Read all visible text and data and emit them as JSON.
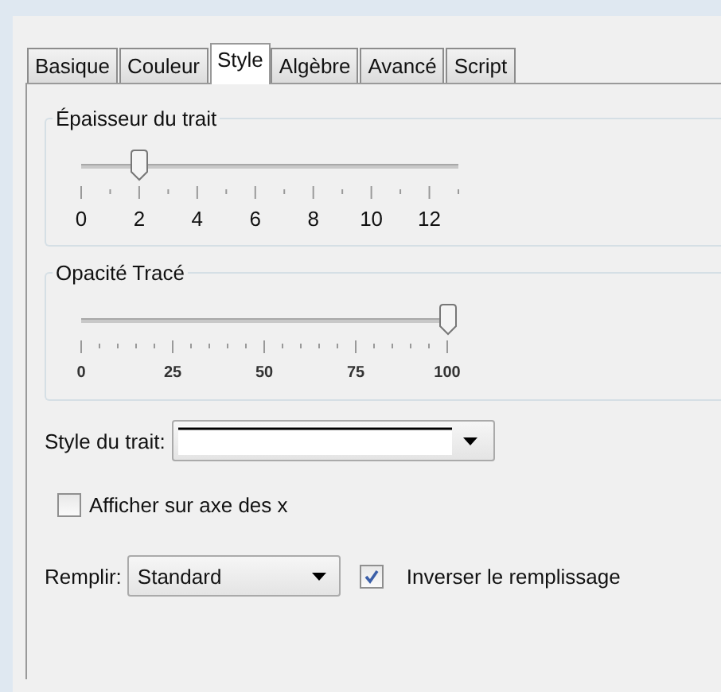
{
  "tabs": [
    {
      "label": "Basique",
      "selected": false
    },
    {
      "label": "Couleur",
      "selected": false
    },
    {
      "label": "Style",
      "selected": true
    },
    {
      "label": "Algèbre",
      "selected": false
    },
    {
      "label": "Avancé",
      "selected": false
    },
    {
      "label": "Script",
      "selected": false
    }
  ],
  "sliders": [
    {
      "title": "Épaisseur du trait",
      "level": 0.154,
      "labels": [
        "0",
        "2",
        "4",
        "6",
        "8",
        "10",
        "12"
      ]
    },
    {
      "title": "Opacité Tracé",
      "level": 1,
      "labels": [
        "0",
        "25",
        "50",
        "75",
        "100"
      ]
    }
  ],
  "line_style": {
    "label": "Style du trait:"
  },
  "show_on_x_axis": {
    "label": "Afficher sur axe des x",
    "checked": false
  },
  "fill": {
    "label": "Remplir:",
    "value": "Standard"
  },
  "invert_fill": {
    "label": "Inverser le remplissage",
    "checked": true
  }
}
